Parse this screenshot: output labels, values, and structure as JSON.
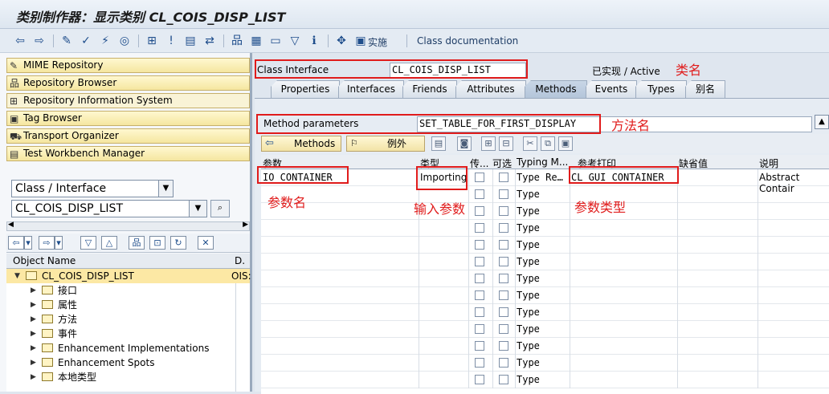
{
  "window": {
    "title": "类别制作器：显示类别 CL_COIS_DISP_LIST"
  },
  "toolbar": {
    "activate_label": "实施",
    "class_doc_label": "Class documentation"
  },
  "nav": {
    "items": [
      {
        "label": "MIME Repository",
        "icon": "mime-icon"
      },
      {
        "label": "Repository Browser",
        "icon": "browser-icon"
      },
      {
        "label": "Repository Information System",
        "icon": "info-system-icon"
      },
      {
        "label": "Tag Browser",
        "icon": "tag-icon"
      },
      {
        "label": "Transport Organizer",
        "icon": "truck-icon"
      },
      {
        "label": "Test Workbench Manager",
        "icon": "test-icon"
      }
    ]
  },
  "browser": {
    "object_type": "Class / Interface",
    "object_name": "CL_COIS_DISP_LIST",
    "tree_header": {
      "name": "Object Name",
      "desc": "D."
    },
    "root": {
      "label": "CL_COIS_DISP_LIST",
      "desc": "OIS:"
    },
    "children": [
      "接口",
      "属性",
      "方法",
      "事件",
      "Enhancement Implementations",
      "Enhancement Spots",
      "本地类型"
    ]
  },
  "class": {
    "label": "Class Interface",
    "value": "CL_COIS_DISP_LIST",
    "status": "已实现 / Active",
    "annotation": "类名"
  },
  "tabs": [
    "Properties",
    "Interfaces",
    "Friends",
    "Attributes",
    "Methods",
    "Events",
    "Types",
    "别名"
  ],
  "method": {
    "label": "Method parameters",
    "value": "SET_TABLE_FOR_FIRST_DISPLAY",
    "annotation": "方法名"
  },
  "method_bar": {
    "methods_label": "Methods",
    "exceptions_label": "例外"
  },
  "grid": {
    "headers": [
      "参数",
      "类型",
      "传...",
      "可选",
      "Typing M...",
      "参考打印",
      "缺省值",
      "说明"
    ],
    "first_row": {
      "param": "IO_CONTAINER",
      "type": "Importing",
      "typing": "Type Re…",
      "ref": "CL_GUI_CONTAINER",
      "desc": "Abstract Contair"
    },
    "empty_typing": "Type",
    "empty_row_count": 12
  },
  "annotations": {
    "param_name": "参数名",
    "input_param": "输入参数",
    "param_type": "参数类型"
  }
}
